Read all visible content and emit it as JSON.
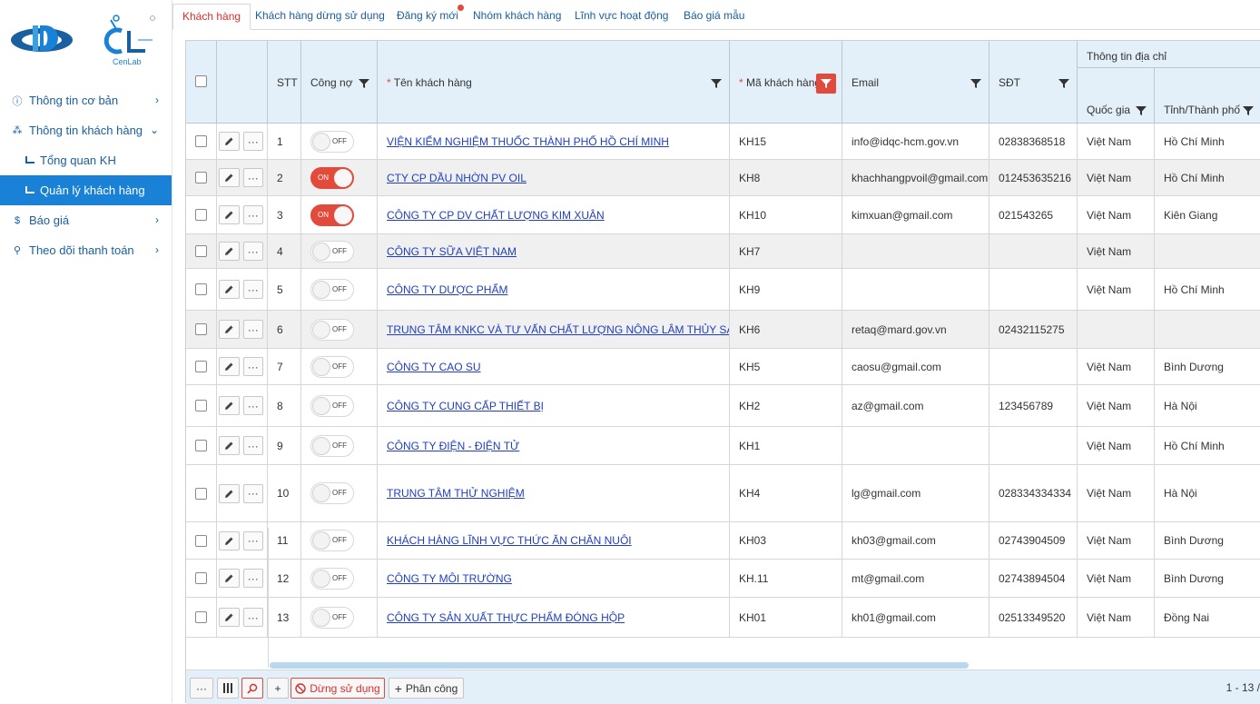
{
  "sidebar": {
    "logo_left": "",
    "logo_right_text": "CenLab",
    "items": [
      {
        "label": "Thông tin cơ bản",
        "icon": "info-circle-icon"
      },
      {
        "label": "Thông tin khách hàng",
        "icon": "sitemap-icon"
      },
      {
        "label": "Tổng quan KH"
      },
      {
        "label": "Quản lý khách hàng"
      },
      {
        "label": "Báo giá",
        "icon": "dollar-icon"
      },
      {
        "label": "Theo dõi thanh toán",
        "icon": "search-icon"
      }
    ]
  },
  "tabs": [
    "Khách hàng",
    "Khách hàng dừng sử dụng",
    "Đăng ký mới",
    "Nhóm khách hàng",
    "Lĩnh vực hoạt động",
    "Báo giá mẫu"
  ],
  "columns": {
    "stt": "STT",
    "debt": "Công nợ",
    "name": "Tên khách hàng",
    "code": "Mã khách hàng",
    "email": "Email",
    "phone": "SĐT",
    "address_group": "Thông tin địa chỉ",
    "country": "Quốc gia",
    "city": "Tỉnh/Thành phố",
    "required_mark": "*"
  },
  "toggle": {
    "on": "ON",
    "off": "OFF"
  },
  "rows": [
    {
      "stt": "1",
      "debt": false,
      "name": "VIỆN KIỂM NGHIỆM THUỐC THÀNH PHỐ HỒ CHÍ MINH",
      "code": "KH15",
      "email": "info@idqc-hcm.gov.vn",
      "phone": "02838368518",
      "country": "Việt Nam",
      "city": "Hồ Chí Minh"
    },
    {
      "stt": "2",
      "debt": true,
      "name": "CTY CP DẦU NHỜN PV OIL",
      "code": "KH8",
      "email": "khachhangpvoil@gmail.com",
      "phone": "012453635216",
      "country": "Việt Nam",
      "city": "Hồ Chí Minh"
    },
    {
      "stt": "3",
      "debt": true,
      "name": "CÔNG TY CP DV CHẤT LƯỢNG KIM XUÂN",
      "code": "KH10",
      "email": "kimxuan@gmail.com",
      "phone": "021543265",
      "country": "Việt Nam",
      "city": "Kiên Giang"
    },
    {
      "stt": "4",
      "debt": false,
      "name": "CÔNG TY SỮA VIỆT NAM",
      "code": "KH7",
      "email": "",
      "phone": "",
      "country": "Việt Nam",
      "city": ""
    },
    {
      "stt": "5",
      "debt": false,
      "name": "CÔNG TY DƯỢC PHẨM",
      "code": "KH9",
      "email": "",
      "phone": "",
      "country": "Việt Nam",
      "city": "Hồ Chí Minh"
    },
    {
      "stt": "6",
      "debt": false,
      "name": "TRUNG TÂM KNKC VÀ TƯ VẤN CHẤT LƯỢNG NÔNG LÂM THỦY SẢN",
      "code": "KH6",
      "email": "retaq@mard.gov.vn",
      "phone": "02432115275",
      "country": "",
      "city": ""
    },
    {
      "stt": "7",
      "debt": false,
      "name": "CÔNG TY CAO SU",
      "code": "KH5",
      "email": "caosu@gmail.com",
      "phone": "",
      "country": "Việt Nam",
      "city": "Bình Dương"
    },
    {
      "stt": "8",
      "debt": false,
      "name": "CÔNG TY CUNG CẤP THIẾT BỊ",
      "code": "KH2",
      "email": "az@gmail.com",
      "phone": "123456789",
      "country": "Việt Nam",
      "city": "Hà Nội"
    },
    {
      "stt": "9",
      "debt": false,
      "name": "CÔNG TY ĐIỆN - ĐIỆN TỬ",
      "code": "KH1",
      "email": "",
      "phone": "",
      "country": "Việt Nam",
      "city": "Hồ Chí Minh"
    },
    {
      "stt": "10",
      "debt": false,
      "name": "TRUNG TÂM THỬ NGHIỆM",
      "code": "KH4",
      "email": "lg@gmail.com",
      "phone": "028334334334",
      "country": "Việt Nam",
      "city": "Hà Nội"
    },
    {
      "stt": "11",
      "debt": false,
      "name": "KHÁCH HÀNG LĨNH VỰC THỨC ĂN CHĂN NUÔI",
      "code": "KH03",
      "email": "kh03@gmail.com",
      "phone": "02743904509",
      "country": "Việt Nam",
      "city": "Bình Dương"
    },
    {
      "stt": "12",
      "debt": false,
      "name": "CÔNG TY MÔI TRƯỜNG",
      "code": "KH.11",
      "email": "mt@gmail.com",
      "phone": "02743894504",
      "country": "Việt Nam",
      "city": "Bình Dương"
    },
    {
      "stt": "13",
      "debt": false,
      "name": "CÔNG TY SẢN XUẤT THỰC PHẨM ĐÓNG HỘP",
      "code": "KH01",
      "email": "kh01@gmail.com",
      "phone": "02513349520",
      "country": "Việt Nam",
      "city": "Đồng Nai"
    }
  ],
  "footer": {
    "more": "···",
    "stop_label": "Dừng sử dụng",
    "assign_label": "Phân công",
    "add": "+",
    "pager": "1 - 13 /"
  },
  "colors": {
    "accent": "#1a82d6",
    "danger": "#e24a3b",
    "link": "#1f3fbf",
    "header_bg": "#e3eff9"
  }
}
